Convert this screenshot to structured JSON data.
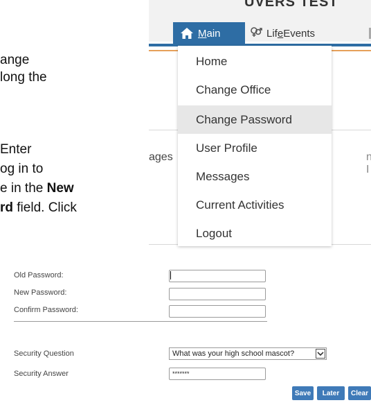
{
  "document": {
    "lines": [
      "ange",
      "long the",
      "Enter",
      "og in to",
      "e in the",
      "New",
      "rd",
      "field. Click"
    ]
  },
  "app": {
    "title": "UVERS TEST",
    "nav": {
      "main_label_prefix": "",
      "main_label_underlined": "M",
      "main_label_rest": "ain",
      "life_label_a": "Lif",
      "life_label_underlined": "e",
      "life_label_b": " Events"
    },
    "side_text_left": "ages",
    "side_text_right": "n I",
    "colors": {
      "nav_blue": "#2e6da4",
      "rule_orange": "#e6a05a",
      "button_blue": "#3f7ab8"
    }
  },
  "dropdown": {
    "items": [
      {
        "label": "Home"
      },
      {
        "label": "Change Office"
      },
      {
        "label": "Change Password",
        "active": true
      },
      {
        "label": "User Profile"
      },
      {
        "label": "Messages"
      },
      {
        "label": "Current Activities"
      },
      {
        "label": "Logout"
      }
    ]
  },
  "form": {
    "old_password_label": "Old Password:",
    "new_password_label": "New Password:",
    "confirm_password_label": "Confirm Password:",
    "security_question_label": "Security Question",
    "security_answer_label": "Security Answer",
    "security_question_value": "What was your high school mascot?",
    "security_answer_value": "*******",
    "buttons": {
      "save": "Save",
      "later": "Later",
      "clear": "Clear"
    }
  }
}
